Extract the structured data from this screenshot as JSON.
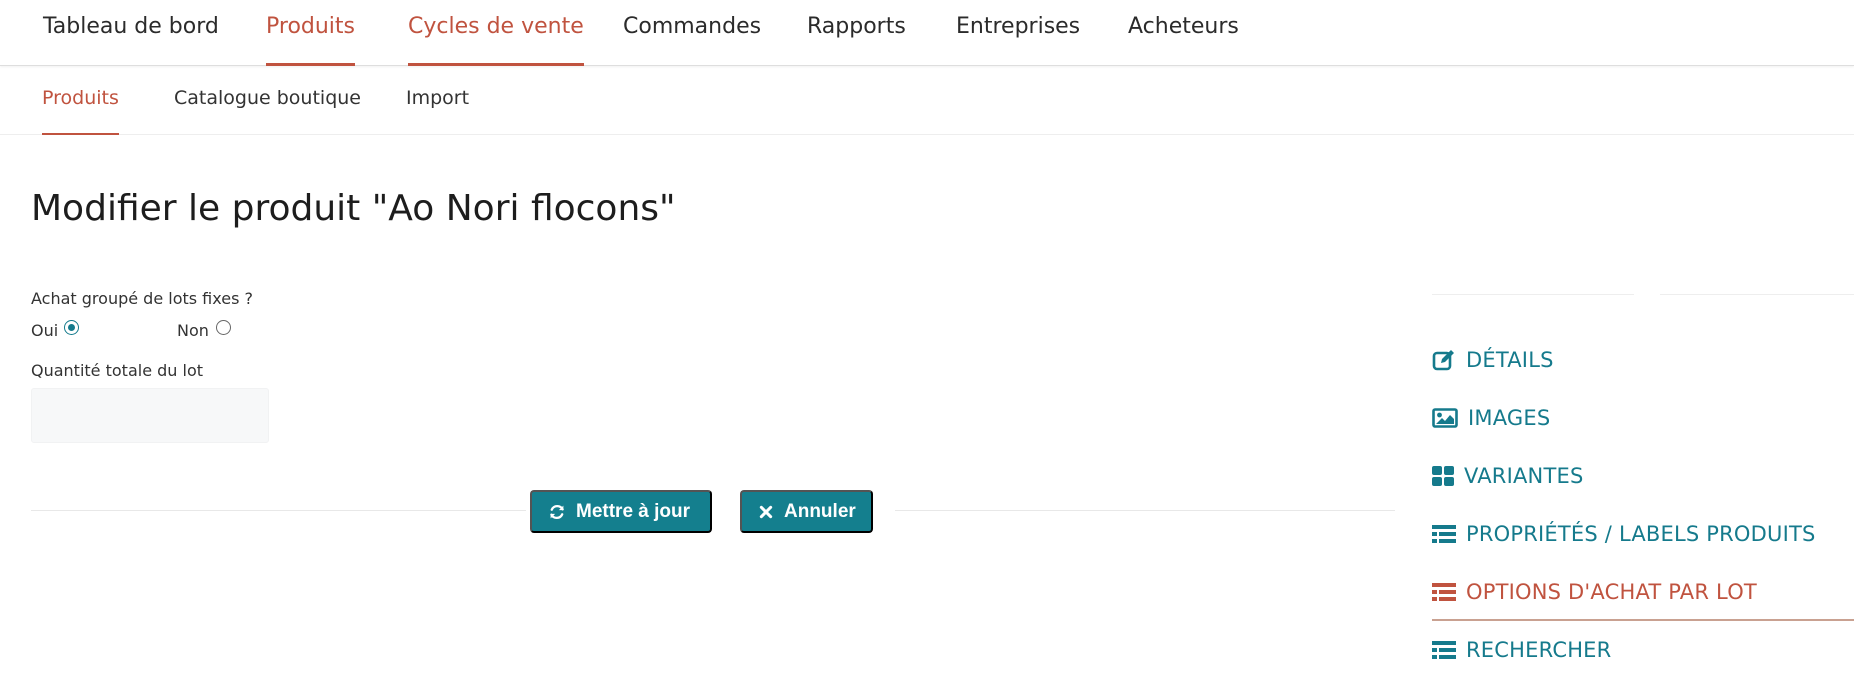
{
  "top_nav": {
    "items": [
      {
        "label": "Tableau de bord"
      },
      {
        "label": "Produits"
      },
      {
        "label": "Cycles de vente"
      },
      {
        "label": "Commandes"
      },
      {
        "label": "Rapports"
      },
      {
        "label": "Entreprises"
      },
      {
        "label": "Acheteurs"
      }
    ],
    "active_indices": [
      1,
      2
    ]
  },
  "sub_nav": {
    "items": [
      {
        "label": "Produits"
      },
      {
        "label": "Catalogue boutique"
      },
      {
        "label": "Import"
      }
    ],
    "active_index": 0
  },
  "page": {
    "title": "Modifier le produit \"Ao Nori flocons\""
  },
  "form": {
    "fixed_lots_question": "Achat groupé de lots fixes ?",
    "options": [
      {
        "label": "Oui",
        "selected": true
      },
      {
        "label": "Non",
        "selected": false
      }
    ],
    "lot_quantity_label": "Quantité totale du lot",
    "lot_quantity_value": ""
  },
  "actions": {
    "update_label": "Mettre à jour",
    "update_icon": "refresh-icon",
    "cancel_label": "Annuler",
    "cancel_icon": "close-icon"
  },
  "side_menu": {
    "items": [
      {
        "label": "DÉTAILS",
        "icon": "edit-icon"
      },
      {
        "label": "IMAGES",
        "icon": "image-icon"
      },
      {
        "label": "VARIANTES",
        "icon": "grid-icon"
      },
      {
        "label": "PROPRIÉTÉS / LABELS PRODUITS",
        "icon": "list-icon"
      },
      {
        "label": "OPTIONS D'ACHAT PAR LOT",
        "icon": "list-icon"
      },
      {
        "label": "RECHERCHER",
        "icon": "list-icon"
      }
    ],
    "active_index": 4
  },
  "colors": {
    "accent": "#c0533f",
    "primary": "#147f8e",
    "sidebar_link": "#157a8c"
  }
}
